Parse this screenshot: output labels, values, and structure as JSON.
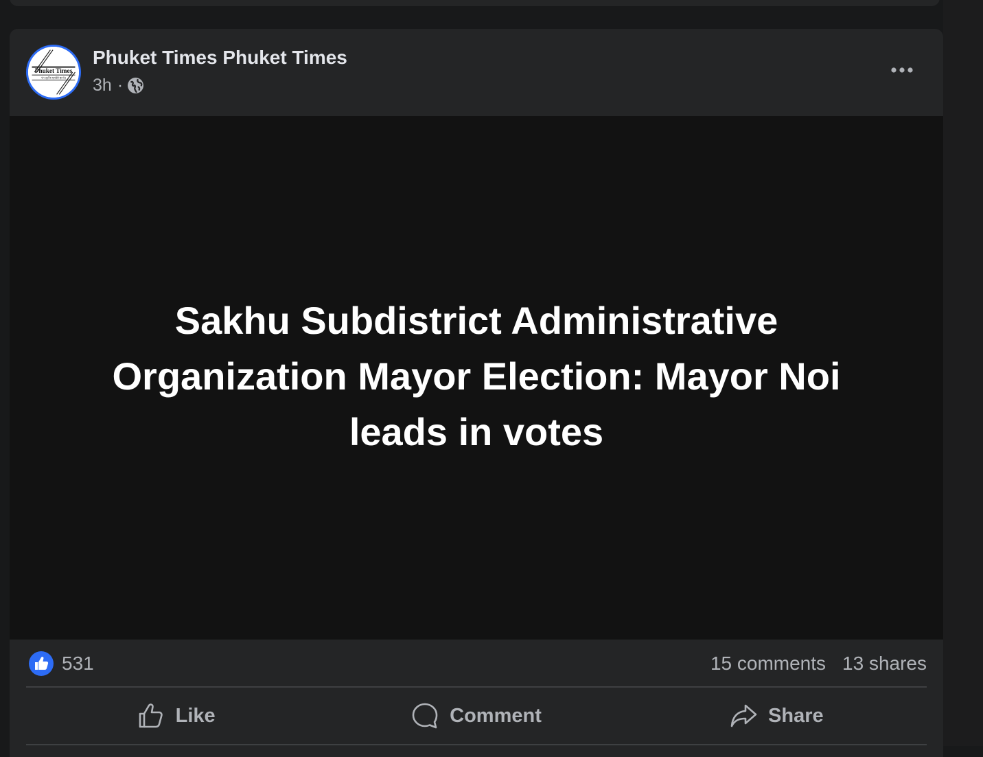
{
  "post": {
    "author": "Phuket Times Phuket Times",
    "time": "3h",
    "separator": "·",
    "visibility_icon": "globe-icon",
    "avatar_text": {
      "line1": "Phuket Times",
      "line2": "ข่าวภูเก็ต ทุกมิติ ทุกวัน"
    },
    "headline": "Sakhu Subdistrict Administrative Organization Mayor Election: Mayor Noi leads in votes",
    "more_icon": "more-horizontal-icon"
  },
  "stats": {
    "reaction_icon": "like-reaction-icon",
    "reaction_count": "531",
    "comments": "15 comments",
    "shares": "13 shares"
  },
  "actions": {
    "like": "Like",
    "comment": "Comment",
    "share": "Share"
  },
  "colors": {
    "background": "#18191a",
    "card": "#242526",
    "media": "#121212",
    "accent": "#2d6cf5",
    "secondary_text": "#b0b3b8"
  }
}
